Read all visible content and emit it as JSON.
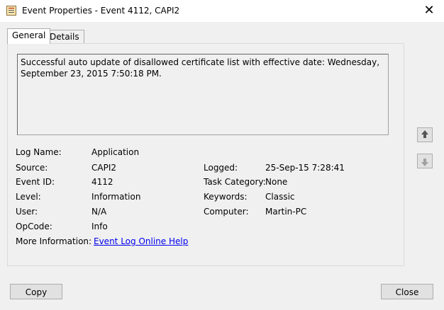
{
  "window": {
    "title": "Event Properties - Event 4112, CAPI2",
    "close_glyph": "✕"
  },
  "tabs": [
    {
      "label": "General",
      "active": true
    },
    {
      "label": "Details",
      "active": false
    }
  ],
  "description": "Successful auto update of disallowed certificate list with effective date: Wednesday, September 23, 2015 7:50:18 PM.",
  "fields": {
    "log_name": {
      "label": "Log Name:",
      "value": "Application"
    },
    "source": {
      "label": "Source:",
      "value": "CAPI2"
    },
    "event_id": {
      "label": "Event ID:",
      "value": "4112"
    },
    "level": {
      "label": "Level:",
      "value": "Information"
    },
    "user": {
      "label": "User:",
      "value": "N/A"
    },
    "opcode": {
      "label": "OpCode:",
      "value": "Info"
    },
    "more_info": {
      "label": "More Information:",
      "value": "Event Log Online Help"
    },
    "logged": {
      "label": "Logged:",
      "value": "25-Sep-15 7:28:41"
    },
    "task_category": {
      "label": "Task Category:",
      "value": "None"
    },
    "keywords": {
      "label": "Keywords:",
      "value": "Classic"
    },
    "computer": {
      "label": "Computer:",
      "value": "Martin-PC"
    }
  },
  "buttons": {
    "copy": "Copy",
    "close": "Close"
  },
  "icons": {
    "app": "event-viewer-icon",
    "up": "arrow-up-icon",
    "down": "arrow-down-icon"
  }
}
